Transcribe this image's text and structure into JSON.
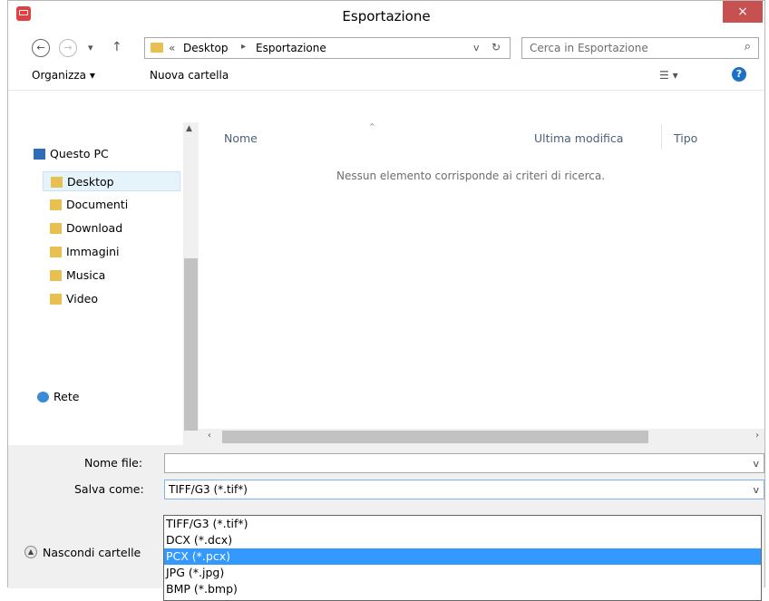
{
  "window": {
    "title": "Esportazione",
    "close_glyph": "×"
  },
  "nav": {
    "back_glyph": "←",
    "forward_glyph": "→",
    "recent_glyph": "▾",
    "up_glyph": "↑",
    "breadcrumb_prefix": "«",
    "breadcrumb": [
      "Desktop",
      "Esportazione"
    ],
    "separator": "▸",
    "refresh_glyph": "↻",
    "address_dropdown_glyph": "v",
    "search_placeholder": "Cerca in Esportazione",
    "search_glyph": "⌕"
  },
  "toolbar": {
    "organize_label": "Organizza ▾",
    "new_folder_label": "Nuova cartella",
    "view_glyph": "☰ ▾",
    "help_glyph": "?"
  },
  "sidebar": {
    "items": [
      {
        "label": "Questo PC",
        "icon": "computer-icon"
      },
      {
        "label": "Desktop",
        "icon": "desktop-folder-icon",
        "selected": true
      },
      {
        "label": "Documenti",
        "icon": "documents-folder-icon"
      },
      {
        "label": "Download",
        "icon": "downloads-folder-icon"
      },
      {
        "label": "Immagini",
        "icon": "pictures-folder-icon"
      },
      {
        "label": "Musica",
        "icon": "music-folder-icon"
      },
      {
        "label": "Video",
        "icon": "video-folder-icon"
      },
      {
        "label": "Rete",
        "icon": "network-icon"
      }
    ]
  },
  "columns": {
    "name": "Nome",
    "modified": "Ultima modifica",
    "type": "Tipo"
  },
  "empty_message": "Nessun elemento corrisponde ai criteri di ricerca.",
  "filename": {
    "label": "Nome file:",
    "value": ""
  },
  "saveas": {
    "label": "Salva come:",
    "value": "TIFF/G3 (*.tif*)"
  },
  "dropdown_options": [
    "TIFF/G3 (*.tif*)",
    "DCX (*.dcx)",
    "PCX (*.pcx)",
    "JPG (*.jpg)",
    "BMP (*.bmp)"
  ],
  "dropdown_highlighted": "PCX (*.pcx)",
  "hide_folders_label": "Nascondi cartelle",
  "colors": {
    "accent": "#3399ff",
    "close": "#c75050",
    "selection": "#e5f3fb"
  }
}
